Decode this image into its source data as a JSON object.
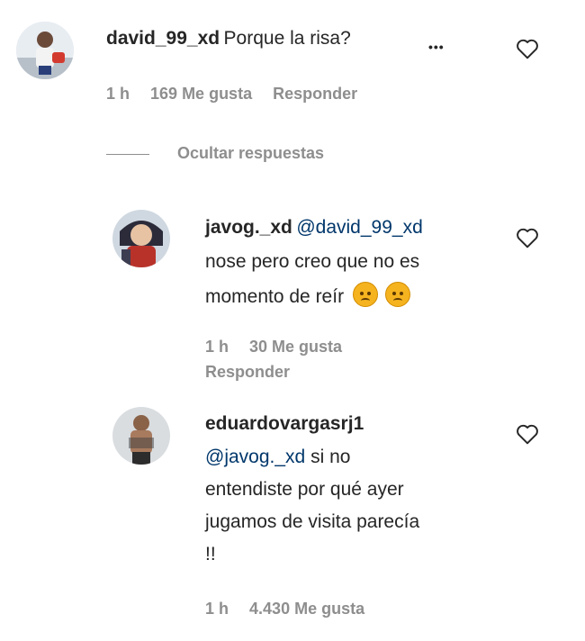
{
  "comment": {
    "username": "david_99_xd",
    "text": "Porque la risa?",
    "more": "•••",
    "time": "1 h",
    "likes": "169 Me gusta",
    "reply": "Responder"
  },
  "toggle_replies": "Ocultar respuestas",
  "replies": [
    {
      "username": "javog._xd",
      "mention": "@david_99_xd",
      "line1": "nose pero creo que no es",
      "line2": "momento de reír",
      "emojis": [
        "pensive-face",
        "pensive-face"
      ],
      "time": "1 h",
      "likes": "30 Me gusta",
      "reply": "Responder"
    },
    {
      "username": "eduardovargasrj1",
      "mention": "@javog._xd",
      "line1": "si no",
      "line2": "entendiste por qué ayer",
      "line3": "jugamos de visita parecía",
      "line4": "!!",
      "time": "1 h",
      "likes": "4.430 Me gusta"
    }
  ],
  "icons": {
    "like": "heart-outline-icon",
    "more": "more-dots-icon"
  },
  "colors": {
    "text": "#262626",
    "secondary": "#8e8e8e",
    "mention": "#00376b"
  }
}
